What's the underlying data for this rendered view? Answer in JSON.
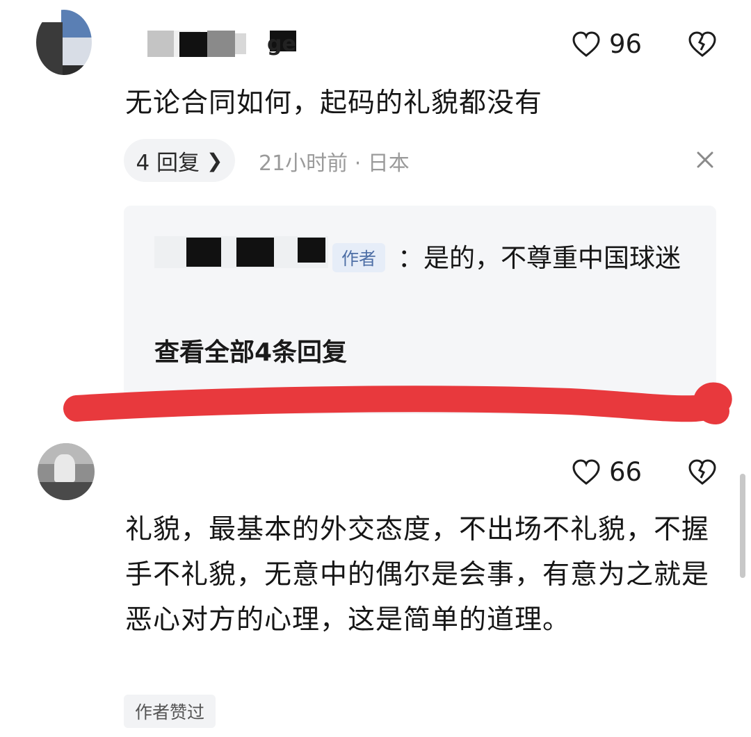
{
  "comment1": {
    "username_visible_fragment": "ge",
    "likes": "96",
    "text": "无论合同如何，起码的礼貌都没有",
    "reply_count_label": "4 回复",
    "time_location": "21小时前 · 日本"
  },
  "reply": {
    "author_badge": "作者",
    "text": "：是的，不尊重中国球迷",
    "view_all_label": "查看全部4条回复"
  },
  "comment2": {
    "likes": "66",
    "text": "礼貌，最基本的外交态度，不出场不礼貌，不握手不礼貌，无意中的偶尔是会事，有意为之就是恶心对方的心理，这是简单的道理。",
    "author_liked_label": "作者赞过"
  },
  "colors": {
    "annotation_stroke": "#e8393d",
    "badge_text": "#4e6fa6",
    "badge_bg": "#e6edf8"
  },
  "icons": [
    "heart-icon",
    "broken-heart-icon",
    "close-icon",
    "chevron-right-icon"
  ]
}
